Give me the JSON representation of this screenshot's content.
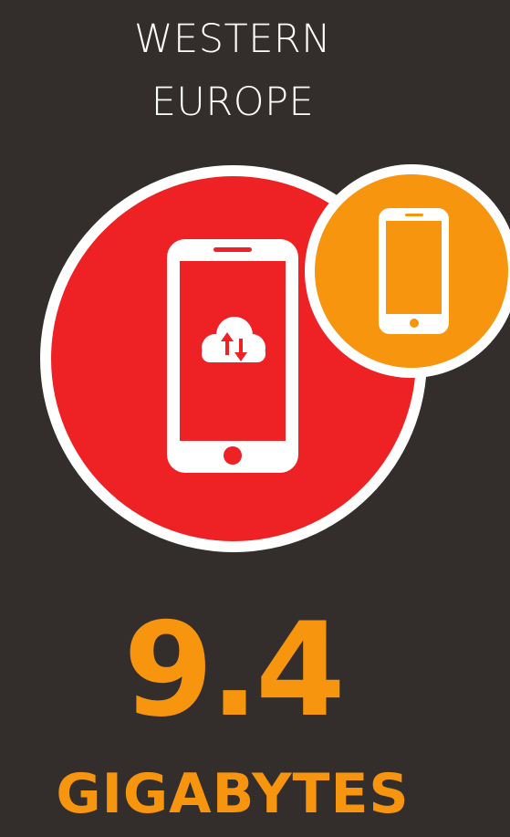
{
  "region": {
    "line1": "WESTERN",
    "line2": "EUROPE"
  },
  "stat": {
    "value": "9.4",
    "unit": "GIGABYTES"
  },
  "icons": {
    "main": "smartphone-cloud-transfer-icon",
    "secondary": "smartphone-icon"
  },
  "colors": {
    "background": "#332e2b",
    "accent_red": "#ee2224",
    "accent_orange": "#f7950f",
    "text_white": "#ffffff"
  }
}
